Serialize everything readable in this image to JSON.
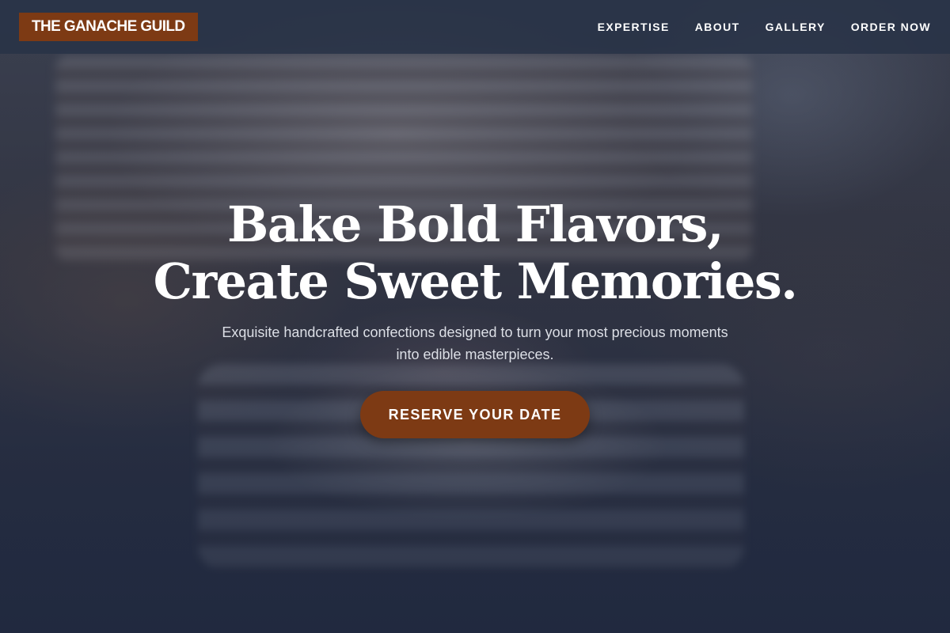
{
  "header": {
    "brand": "THE GANACHE GUILD",
    "nav": [
      {
        "label": "EXPERTISE"
      },
      {
        "label": "ABOUT"
      },
      {
        "label": "GALLERY"
      },
      {
        "label": "ORDER NOW"
      }
    ]
  },
  "hero": {
    "headline_line1": "Bake Bold Flavors,",
    "headline_line2": "Create Sweet Memories.",
    "subtext": "Exquisite handcrafted confections designed to turn your most precious moments into edible masterpieces.",
    "cta_label": "RESERVE YOUR DATE"
  },
  "colors": {
    "accent": "#7d3a14",
    "header_bg": "#283246",
    "text": "#ffffff"
  }
}
